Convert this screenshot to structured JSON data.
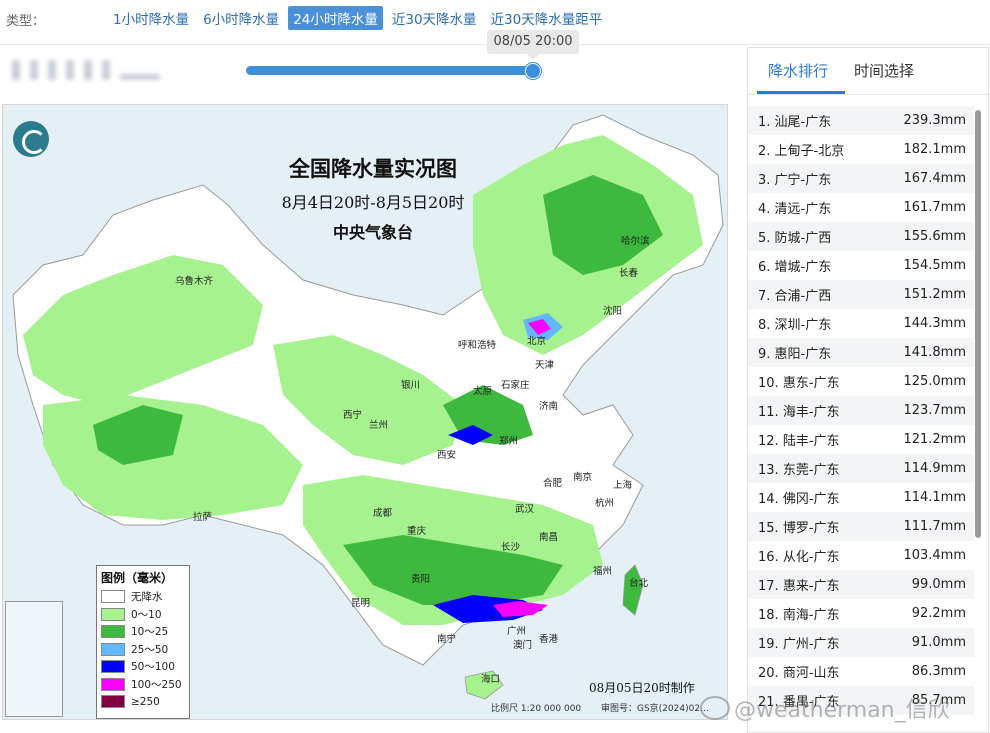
{
  "typebar": {
    "label": "类型：",
    "tabs": [
      {
        "label": "1小时降水量",
        "active": false
      },
      {
        "label": "6小时降水量",
        "active": false
      },
      {
        "label": "24小时降水量",
        "active": true
      },
      {
        "label": "近30天降水量",
        "active": false
      },
      {
        "label": "近30天降水量距平",
        "active": false
      }
    ]
  },
  "timeline": {
    "current_time": "08/05 20:00",
    "progress": 1.0
  },
  "map": {
    "title": "全国降水量实况图",
    "period": "8月4日20时-8月5日20时",
    "issuer": "中央气象台",
    "made_time": "08月05日20时制作",
    "scale_text": "比例尺 1:20 000 000",
    "review_no": "审图号：GS京(2024)02…",
    "cities": [
      "乌鲁木齐",
      "哈尔滨",
      "长春",
      "沈阳",
      "呼和浩特",
      "北京",
      "天津",
      "银川",
      "太原",
      "石家庄",
      "济南",
      "西宁",
      "兰州",
      "西安",
      "郑州",
      "合肥",
      "南京",
      "上海",
      "杭州",
      "武汉",
      "成都",
      "重庆",
      "拉萨",
      "长沙",
      "南昌",
      "福州",
      "台北",
      "贵阳",
      "昆明",
      "南宁",
      "广州",
      "香港",
      "澳门",
      "海口"
    ],
    "legend": {
      "title": "图例（毫米）",
      "items": [
        {
          "label": "无降水",
          "color": "#ffffff"
        },
        {
          "label": "0～10",
          "color": "#a6f28f"
        },
        {
          "label": "10～25",
          "color": "#3dba3d"
        },
        {
          "label": "25～50",
          "color": "#61b8ff"
        },
        {
          "label": "50～100",
          "color": "#0000ff"
        },
        {
          "label": "100～250",
          "color": "#fa00fa"
        },
        {
          "label": "≥250",
          "color": "#800040"
        }
      ]
    }
  },
  "panel": {
    "tabs": [
      {
        "label": "降水排行",
        "active": true
      },
      {
        "label": "时间选择",
        "active": false
      }
    ],
    "ranking": [
      {
        "rank": "1.",
        "station": "汕尾-广东",
        "value": "239.3mm"
      },
      {
        "rank": "2.",
        "station": "上甸子-北京",
        "value": "182.1mm"
      },
      {
        "rank": "3.",
        "station": "广宁-广东",
        "value": "167.4mm"
      },
      {
        "rank": "4.",
        "station": "清远-广东",
        "value": "161.7mm"
      },
      {
        "rank": "5.",
        "station": "防城-广西",
        "value": "155.6mm"
      },
      {
        "rank": "6.",
        "station": "增城-广东",
        "value": "154.5mm"
      },
      {
        "rank": "7.",
        "station": "合浦-广西",
        "value": "151.2mm"
      },
      {
        "rank": "8.",
        "station": "深圳-广东",
        "value": "144.3mm"
      },
      {
        "rank": "9.",
        "station": "惠阳-广东",
        "value": "141.8mm"
      },
      {
        "rank": "10.",
        "station": "惠东-广东",
        "value": "125.0mm"
      },
      {
        "rank": "11.",
        "station": "海丰-广东",
        "value": "123.7mm"
      },
      {
        "rank": "12.",
        "station": "陆丰-广东",
        "value": "121.2mm"
      },
      {
        "rank": "13.",
        "station": "东莞-广东",
        "value": "114.9mm"
      },
      {
        "rank": "14.",
        "station": "佛冈-广东",
        "value": "114.1mm"
      },
      {
        "rank": "15.",
        "station": "博罗-广东",
        "value": "111.7mm"
      },
      {
        "rank": "16.",
        "station": "从化-广东",
        "value": "103.4mm"
      },
      {
        "rank": "17.",
        "station": "惠来-广东",
        "value": "99.0mm"
      },
      {
        "rank": "18.",
        "station": "南海-广东",
        "value": "92.2mm"
      },
      {
        "rank": "19.",
        "station": "广州-广东",
        "value": "91.0mm"
      },
      {
        "rank": "20.",
        "station": "商河-山东",
        "value": "86.3mm"
      },
      {
        "rank": "21.",
        "station": "番禺-广东",
        "value": "85.7mm"
      }
    ]
  },
  "watermark": "@weatherman_信欣"
}
